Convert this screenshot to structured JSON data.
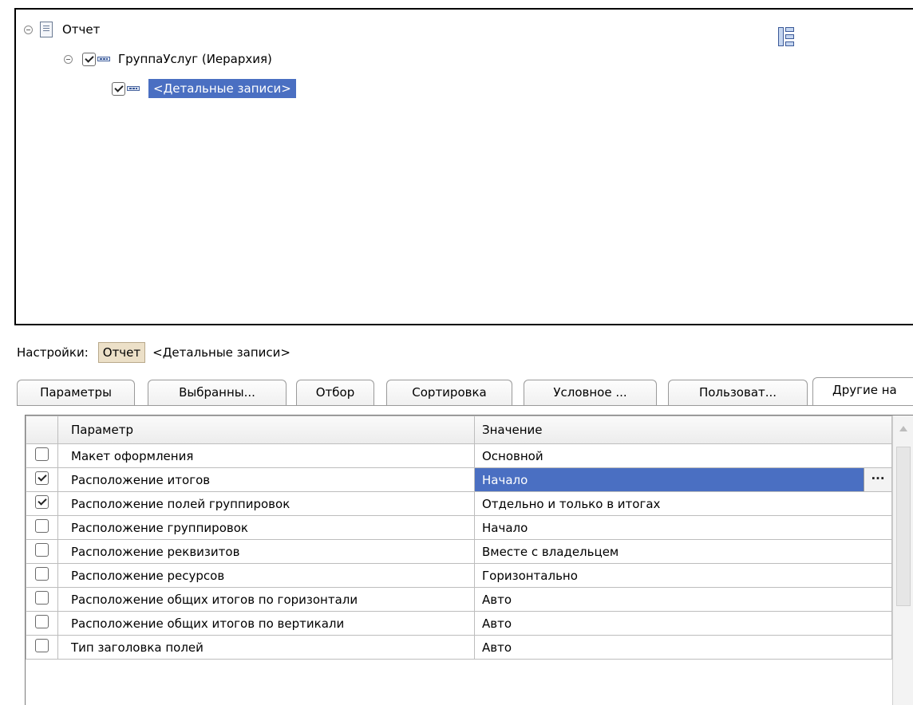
{
  "tree": {
    "root_label": "Отчет",
    "group_label": "ГруппаУслуг (Иерархия)",
    "detail_label": "<Детальные записи>",
    "group_checked": true,
    "detail_checked": true
  },
  "settings": {
    "label": "Настройки:",
    "report_button": "Отчет",
    "current_link": "<Детальные записи>"
  },
  "tabs": [
    {
      "label": "Параметры",
      "active": false
    },
    {
      "label": "Выбранны...",
      "active": false
    },
    {
      "label": "Отбор",
      "active": false
    },
    {
      "label": "Сортировка",
      "active": false
    },
    {
      "label": "Условное ...",
      "active": false
    },
    {
      "label": "Пользоват...",
      "active": false
    },
    {
      "label": "Другие на",
      "active": true
    }
  ],
  "table": {
    "headers": {
      "param": "Параметр",
      "value": "Значение"
    },
    "ellipsis": "...",
    "rows": [
      {
        "checked": false,
        "param": "Макет оформления",
        "value": "Основной"
      },
      {
        "checked": true,
        "param": "Расположение итогов",
        "value": "Начало",
        "selected": true
      },
      {
        "checked": true,
        "param": "Расположение полей группировок",
        "value": "Отдельно и только в итогах"
      },
      {
        "checked": false,
        "param": "Расположение группировок",
        "value": "Начало"
      },
      {
        "checked": false,
        "param": "Расположение реквизитов",
        "value": "Вместе с владельцем"
      },
      {
        "checked": false,
        "param": "Расположение ресурсов",
        "value": "Горизонтально"
      },
      {
        "checked": false,
        "param": "Расположение общих итогов по горизонтали",
        "value": "Авто"
      },
      {
        "checked": false,
        "param": "Расположение общих итогов по вертикали",
        "value": "Авто"
      },
      {
        "checked": false,
        "param": "Тип заголовка полей",
        "value": "Авто"
      }
    ]
  },
  "colors": {
    "selection": "#4a6fc2",
    "settings_button": "#ece0c8"
  }
}
